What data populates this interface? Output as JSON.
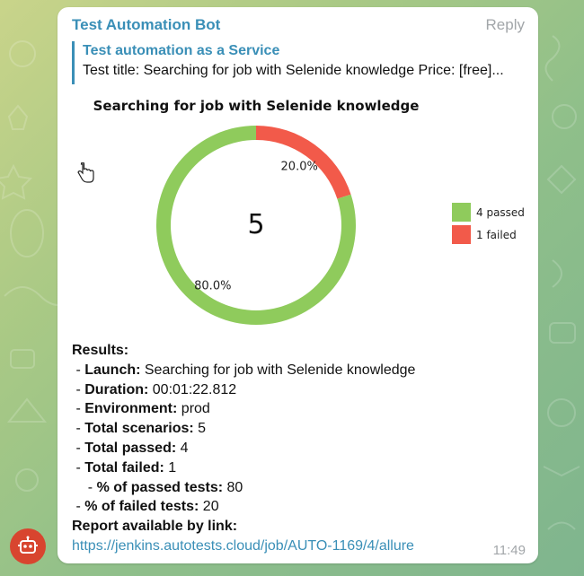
{
  "message": {
    "sender": "Test Automation Bot",
    "reply_label": "Reply",
    "time": "11:49"
  },
  "quote": {
    "title": "Test automation as a Service",
    "text": "Test title: Searching for job with Selenide knowledge Price: [free]..."
  },
  "chart_data": {
    "type": "pie",
    "title": "Searching for job with Selenide knowledge",
    "center_label": "5",
    "slices": [
      {
        "label": "passed",
        "value": 80.0,
        "count": 4,
        "color": "#8fcb5c",
        "pct_label": "80.0%"
      },
      {
        "label": "failed",
        "value": 20.0,
        "count": 1,
        "color": "#f25a4a",
        "pct_label": "20.0%"
      }
    ],
    "legend": [
      "4 passed",
      "1 failed"
    ],
    "legend_placement": "right"
  },
  "results": {
    "heading": "Results:",
    "items": [
      {
        "prefix": " - ",
        "label": "Launch:",
        "value": " Searching for job with Selenide knowledge"
      },
      {
        "prefix": " - ",
        "label": "Duration:",
        "value": " 00:01:22.812"
      },
      {
        "prefix": " - ",
        "label": "Environment:",
        "value": " prod"
      },
      {
        "prefix": " - ",
        "label": "Total scenarios:",
        "value": " 5"
      },
      {
        "prefix": " - ",
        "label": "Total passed:",
        "value": " 4"
      },
      {
        "prefix": " - ",
        "label": "Total failed:",
        "value": " 1"
      },
      {
        "prefix": "    - ",
        "label": "% of passed tests:",
        "value": " 80"
      },
      {
        "prefix": " - ",
        "label": "% of failed tests:",
        "value": " 20"
      }
    ],
    "report_label": " Report available by link:",
    "report_link": "https://jenkins.autotests.cloud/job/AUTO-1169/4/allure"
  },
  "colors": {
    "accent": "#3a8fb7",
    "passed": "#8fcb5c",
    "failed": "#f25a4a",
    "avatar": "#d8452f"
  },
  "icons": {
    "avatar": "robot-icon",
    "cursor": "hand-pointer-icon"
  }
}
